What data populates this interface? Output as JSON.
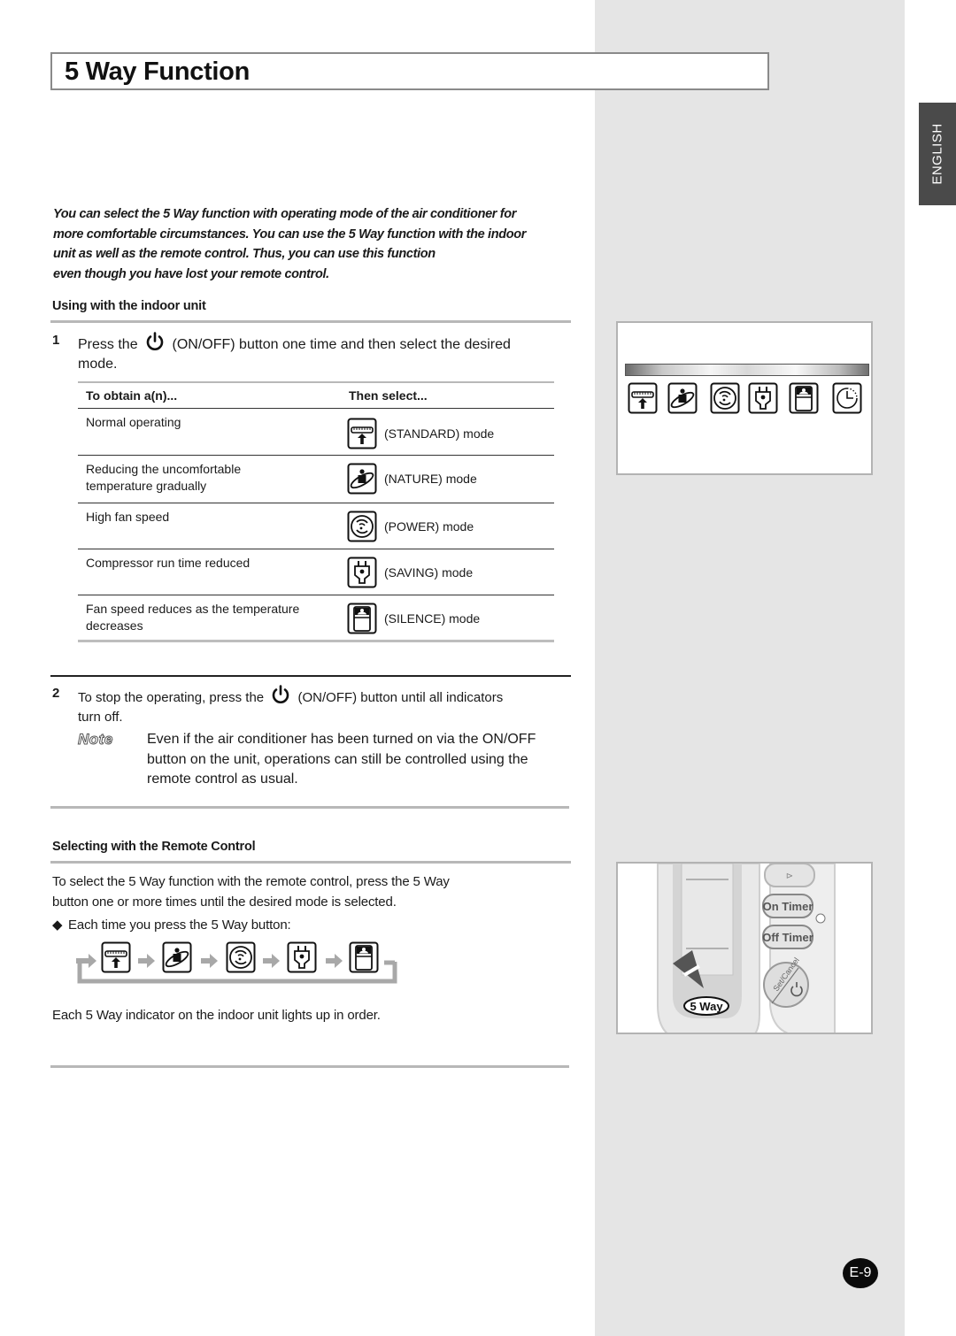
{
  "page": {
    "title": "5 Way Function",
    "language_tab": "ENGLISH",
    "page_number": "E-9"
  },
  "intro": {
    "lines": [
      "You can select the 5 Way function with operating mode of the air conditioner for",
      "more comfortable circumstances. You can use the 5 Way function with the indoor",
      "unit as well as the remote control. Thus, you can use this function",
      "even though you have lost your remote control."
    ]
  },
  "indoor_unit": {
    "heading": "Using with the indoor unit",
    "step1": {
      "number": "1",
      "text_before": "Press the",
      "text_after": "(ON/OFF) button one time and then select the desired",
      "text_line2": "mode.",
      "icon": "power-icon"
    },
    "table": {
      "headers": [
        "To obtain a(n)...",
        "Then select..."
      ],
      "rows": [
        {
          "obtain": "Normal operating",
          "select": "(STANDARD) mode",
          "icon": "standard-mode-icon"
        },
        {
          "obtain": "Reducing the uncomfortable temperature gradually",
          "select": "(NATURE) mode",
          "icon": "nature-mode-icon"
        },
        {
          "obtain": "High fan speed",
          "select": "(POWER) mode",
          "icon": "power-mode-icon"
        },
        {
          "obtain": "Compressor run time reduced",
          "select": "(SAVING) mode",
          "icon": "saving-mode-icon"
        },
        {
          "obtain": "Fan speed reduces as the temperature decreases",
          "select": "(SILENCE) mode",
          "icon": "silence-mode-icon"
        }
      ]
    },
    "step2": {
      "number": "2",
      "text_before": "To stop the operating, press the",
      "text_after": "(ON/OFF) button until all indicators",
      "text_line2": "turn off.",
      "icon": "power-icon"
    },
    "note": {
      "label": "Note",
      "text": "Even if the air conditioner has been turned on via the ON/OFF button on the unit, operations can still be controlled using the remote control as usual."
    }
  },
  "remote_control": {
    "heading": "Selecting with the Remote Control",
    "para_line1": "To select the 5 Way function with the remote control, press the 5 Way",
    "para_line2": "button one or more times until the desired mode is selected.",
    "bullet_icon": "diamond-bullet-icon",
    "bullet": "Each time you press the 5 Way button:",
    "cycle": [
      "standard-mode-icon",
      "nature-mode-icon",
      "power-mode-icon",
      "saving-mode-icon",
      "silence-mode-icon"
    ],
    "footer": "Each 5 Way indicator on the indoor unit lights up in order."
  },
  "illustrations": {
    "indoor_panel_icons": [
      "standard-mode-icon",
      "nature-mode-icon",
      "power-mode-icon",
      "saving-mode-icon",
      "silence-mode-icon",
      "timer-icon"
    ],
    "remote": {
      "on_timer": "On Timer",
      "off_timer": "Off Timer",
      "set_cancel": "Set/Cancel",
      "five_way": "5 Way"
    }
  }
}
